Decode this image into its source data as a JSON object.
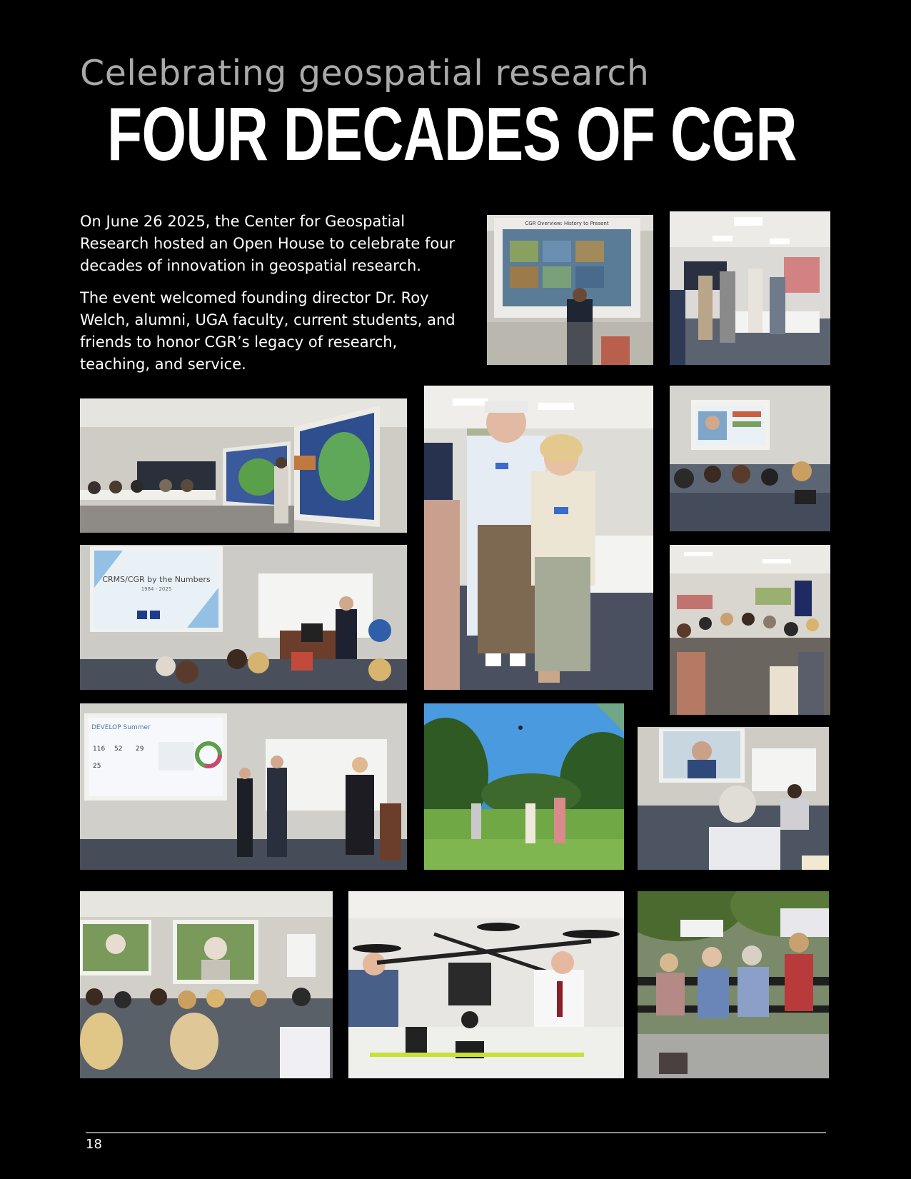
{
  "header": {
    "kicker": "Celebrating geospatial research",
    "title": "FOUR DECADES OF CGR"
  },
  "intro": {
    "paragraph_1": "On June 26 2025, the Center for Geospatial Research hosted an Open House to celebrate four decades of innovation in geospatial research.",
    "paragraph_2": "The event welcomed founding director Dr. Roy Welch, alumni, UGA faculty,  current students, and friends to honor CGR’s legacy of research, teaching, and service."
  },
  "photos": {
    "history_slide": "CGR Overview: History to Present",
    "numbers_slide_title": "CRMS/CGR by the Numbers",
    "numbers_slide_years": "1984 - 2025",
    "develop_slide_title": "DEVELOP Summer",
    "develop_stat_1": "116",
    "develop_stat_2": "52",
    "develop_stat_3": "29",
    "develop_stat_4": "25"
  },
  "footer": {
    "page_number": "18"
  }
}
